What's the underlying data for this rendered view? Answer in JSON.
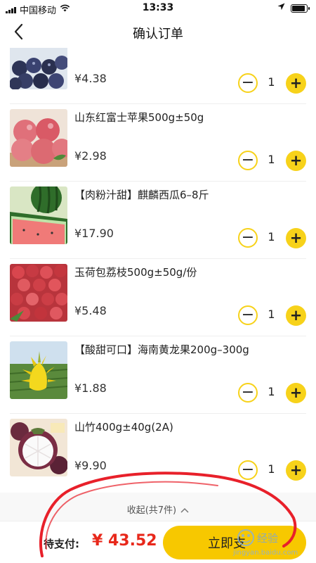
{
  "status_bar": {
    "carrier": "中国移动",
    "time": "13:33"
  },
  "nav": {
    "title": "确认订单"
  },
  "items": [
    {
      "name": "",
      "price": "¥4.38",
      "qty": "1",
      "image": "blueberry-image"
    },
    {
      "name": "山东红富士苹果500g±50g",
      "price": "¥2.98",
      "qty": "1",
      "image": "apple-image"
    },
    {
      "name": "【肉粉汁甜】麒麟西瓜6–8斤",
      "price": "¥17.90",
      "qty": "1",
      "image": "watermelon-image"
    },
    {
      "name": "玉荷包荔枝500g±50g/份",
      "price": "¥5.48",
      "qty": "1",
      "image": "lychee-image"
    },
    {
      "name": "【酸甜可口】海南黄龙果200g–300g",
      "price": "¥1.88",
      "qty": "1",
      "image": "pitaya-image"
    },
    {
      "name": "山竹400g±40g(2A)",
      "price": "¥9.90",
      "qty": "1",
      "image": "mangosteen-image"
    }
  ],
  "stepper": {
    "minus": "−",
    "plus": "+"
  },
  "collapse": {
    "label": "收起(共7件)"
  },
  "bottom": {
    "pay_label": "待支付:",
    "amount": "¥ 43.52",
    "submit": "立即支"
  },
  "watermark": {
    "text": "经验",
    "url": "jingyan.baidu.com"
  },
  "colors": {
    "accent_yellow": "#f7d21a",
    "price_red": "#e8281b",
    "annotation_red": "#e8202a"
  }
}
